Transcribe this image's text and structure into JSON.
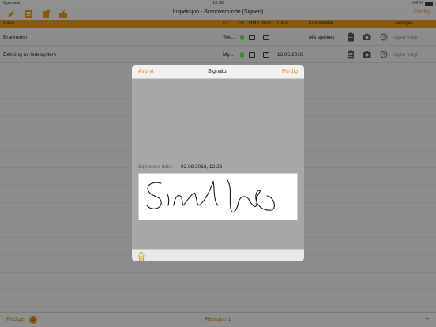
{
  "status_bar": {
    "carrier": "Operatør",
    "time": "13.38",
    "battery": "100 %"
  },
  "nav": {
    "title": "Inspeksjon - Brannverrunde (Signert)",
    "done": "Ferdig"
  },
  "columns": {
    "name": "Navn",
    "group": "Gr.",
    "status": "St.",
    "hms": "HMS",
    "bud": "Bud.",
    "date": "Dato",
    "comment": "Kommentar",
    "supplier": "Leietager"
  },
  "rows": [
    {
      "name": "Brannvern",
      "group": "Tek...",
      "hms_checked": false,
      "bud_checked": false,
      "date": "",
      "comment": "Må sjekkes",
      "supplier": "Ingen valgt"
    },
    {
      "name": "Dekning av ledesystem",
      "group": "My...",
      "hms_checked": false,
      "bud_checked": true,
      "date": "13.05.2016",
      "comment": "",
      "supplier": "Ingen valgt"
    }
  ],
  "modal": {
    "cancel": "Avbryt",
    "title": "Signatur",
    "done": "Ferdig",
    "signature_date_label": "Signature date:",
    "signature_date_value": "02.08.2016, 12.26"
  },
  "bottom": {
    "edit": "Rediger",
    "badge": "1",
    "revision": "Revisjon 1",
    "add": "+"
  },
  "colors": {
    "accent": "#e08f1a",
    "header": "#8a5a0c",
    "status_green": "#2f8f2f"
  }
}
